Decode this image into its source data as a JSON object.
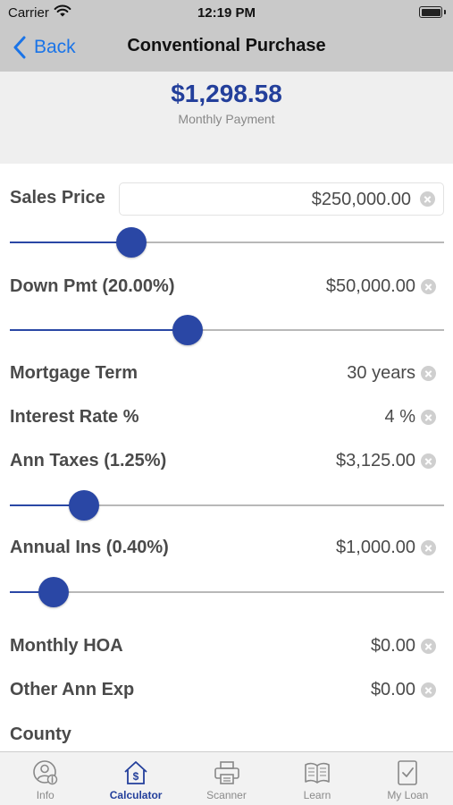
{
  "status_bar": {
    "carrier": "Carrier",
    "time": "12:19 PM"
  },
  "nav": {
    "back_label": "Back",
    "title": "Conventional Purchase"
  },
  "summary": {
    "payment": "$1,298.58",
    "payment_label": "Monthly Payment"
  },
  "colors": {
    "accent": "#2a47a5",
    "ios_blue": "#1a74e8",
    "payment_text": "#233f9b"
  },
  "fields": {
    "sales_price": {
      "label": "Sales Price",
      "value": "$250,000.00"
    },
    "down_payment": {
      "label": "Down Pmt (20.00%)",
      "value": "$50,000.00"
    },
    "mortgage_term": {
      "label": "Mortgage Term",
      "value": "30 years"
    },
    "interest_rate": {
      "label": "Interest Rate %",
      "value": "4 %"
    },
    "ann_taxes": {
      "label": "Ann Taxes (1.25%)",
      "value": "$3,125.00"
    },
    "annual_ins": {
      "label": "Annual Ins (0.40%)",
      "value": "$1,000.00"
    },
    "monthly_hoa": {
      "label": "Monthly HOA",
      "value": "$0.00"
    },
    "other_ann_exp": {
      "label": "Other Ann Exp",
      "value": "$0.00"
    },
    "county": {
      "label": "County"
    }
  },
  "sliders": {
    "sales_price": {
      "level": 0.28
    },
    "down_payment": {
      "level": 0.41
    },
    "ann_taxes": {
      "level": 0.17
    },
    "annual_ins": {
      "level": 0.1
    }
  },
  "tabs": [
    {
      "label": "Info",
      "icon": "info-person-icon",
      "active": false
    },
    {
      "label": "Calculator",
      "icon": "calculator-house-icon",
      "active": true
    },
    {
      "label": "Scanner",
      "icon": "printer-icon",
      "active": false
    },
    {
      "label": "Learn",
      "icon": "book-icon",
      "active": false
    },
    {
      "label": "My Loan",
      "icon": "document-check-icon",
      "active": false
    }
  ]
}
